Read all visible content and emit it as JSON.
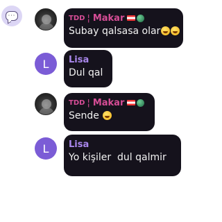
{
  "messages": [
    {
      "author_tag": "TDD",
      "separator": "¦",
      "author": "Makar",
      "text": "Subay qalsasa olar",
      "emoji_count": 2,
      "avatar": "photo"
    },
    {
      "author": "Lisa",
      "avatar_letter": "L",
      "text": "Dul qal"
    },
    {
      "author_tag": "TDD",
      "separator": "¦",
      "author": "Makar",
      "text": "Sende",
      "emoji_count": 1,
      "avatar": "photo"
    },
    {
      "author": "Lisa",
      "avatar_letter": "L",
      "text": "Yo kişiler  dul qalmir"
    }
  ],
  "colors": {
    "bubble_bg": "#15121c",
    "makar_name": "#d64d96",
    "lisa_name": "#a987ec",
    "lisa_avatar": "#7b5cd6"
  },
  "icons": {
    "app": "chat-bubble-icon",
    "flag": "flag-icon",
    "badge": "green-orb-icon",
    "emoji": "laughing-emoji-icon"
  }
}
